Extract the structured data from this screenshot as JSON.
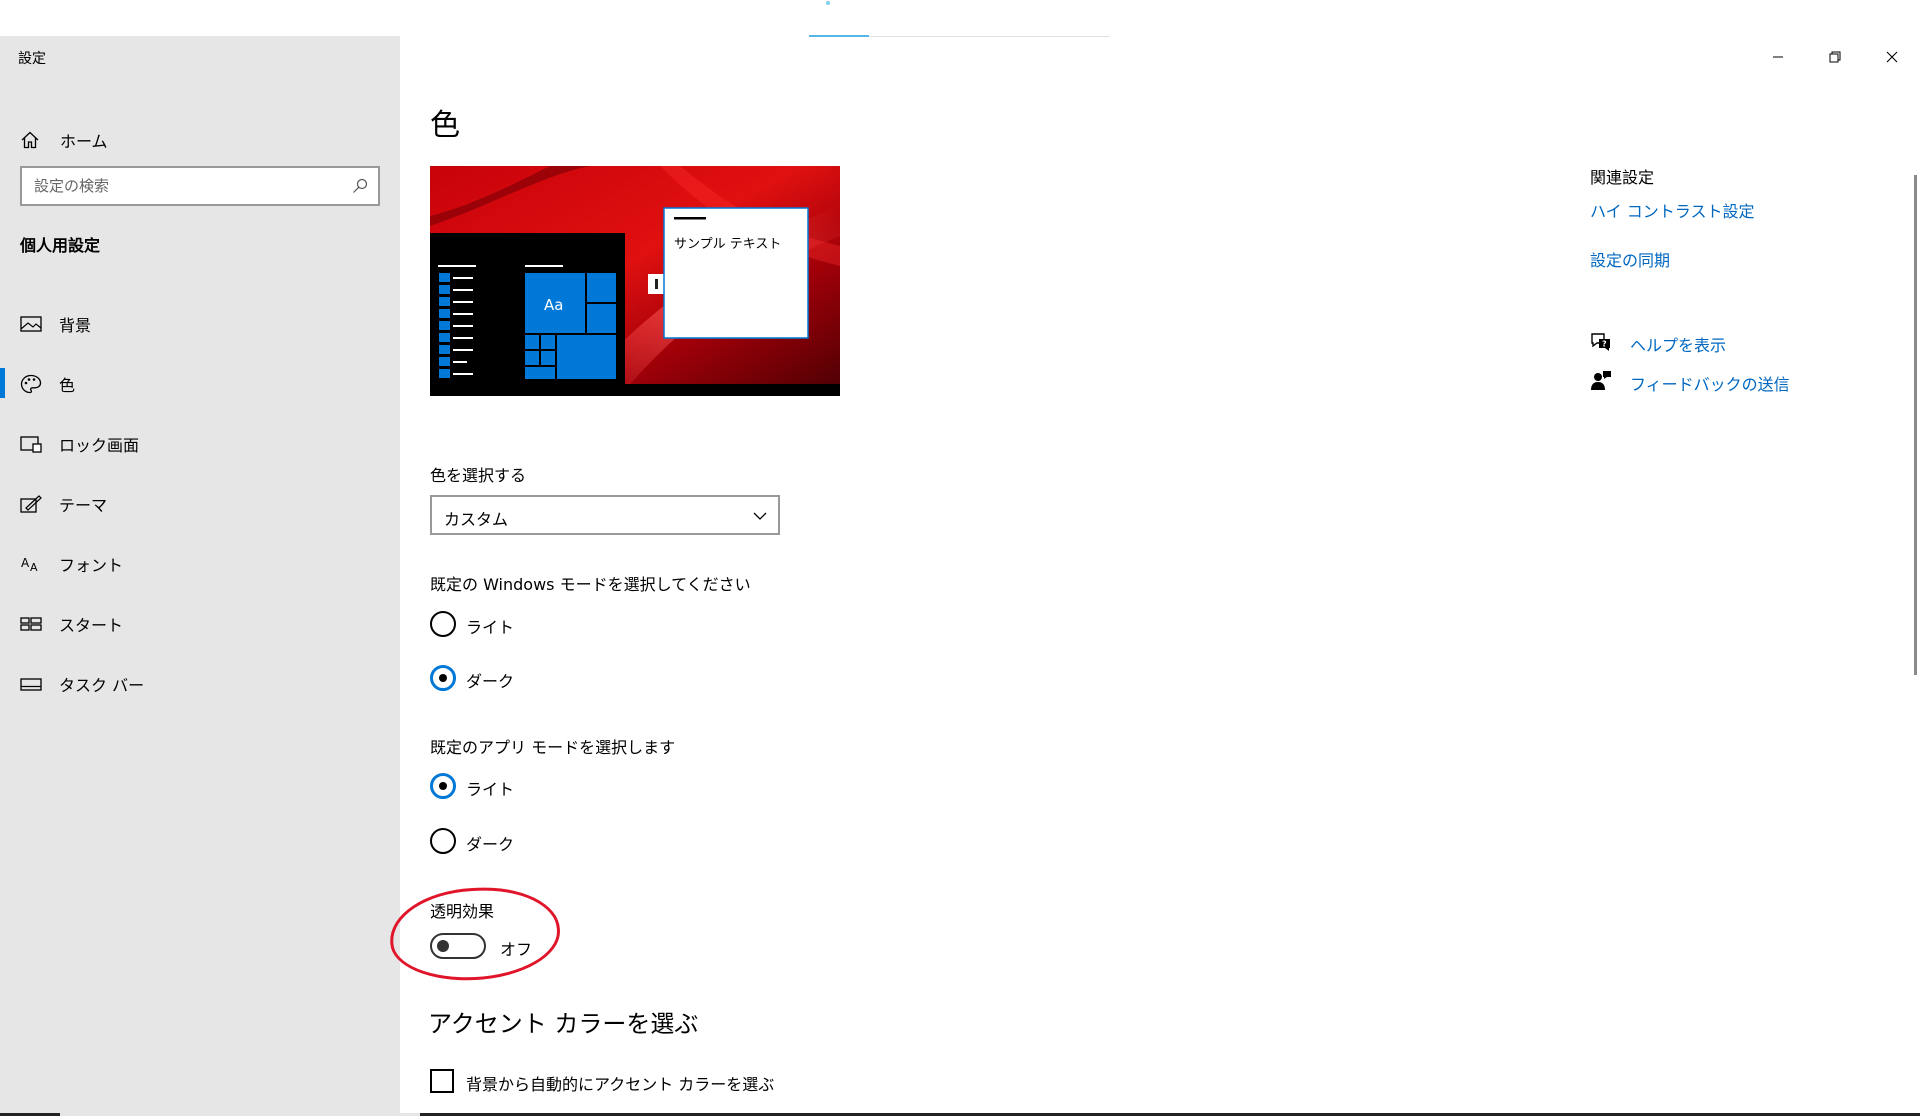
{
  "window": {
    "title": "設定",
    "controls": {
      "minimize": "minimize-icon",
      "maximize": "restore-icon",
      "close": "close-icon"
    }
  },
  "sidebar": {
    "home_label": "ホーム",
    "search_placeholder": "設定の検索",
    "section_title": "個人用設定",
    "items": [
      {
        "label": "背景",
        "icon": "picture-icon"
      },
      {
        "label": "色",
        "icon": "palette-icon",
        "active": true
      },
      {
        "label": "ロック画面",
        "icon": "lock-screen-icon"
      },
      {
        "label": "テーマ",
        "icon": "theme-icon"
      },
      {
        "label": "フォント",
        "icon": "font-icon"
      },
      {
        "label": "スタート",
        "icon": "start-icon"
      },
      {
        "label": "タスク バー",
        "icon": "taskbar-icon"
      }
    ]
  },
  "main": {
    "title": "色",
    "preview": {
      "sample_text": "サンプル テキスト",
      "tile_text": "Aa"
    },
    "choose_color": {
      "label": "色を選択する",
      "value": "カスタム"
    },
    "windows_mode": {
      "label": "既定の Windows モードを選択してください",
      "options": [
        {
          "label": "ライト",
          "checked": false
        },
        {
          "label": "ダーク",
          "checked": true
        }
      ]
    },
    "app_mode": {
      "label": "既定のアプリ モードを選択します",
      "options": [
        {
          "label": "ライト",
          "checked": true
        },
        {
          "label": "ダーク",
          "checked": false
        }
      ]
    },
    "transparency": {
      "label": "透明効果",
      "state": "オフ",
      "on": false
    },
    "accent": {
      "heading": "アクセント カラーを選ぶ",
      "auto_checkbox": "背景から自動的にアクセント カラーを選ぶ",
      "auto_checked": false
    }
  },
  "related": {
    "title": "関連設定",
    "links": [
      "ハイ コントラスト設定",
      "設定の同期"
    ],
    "help": [
      {
        "label": "ヘルプを表示",
        "icon": "help-chat-icon"
      },
      {
        "label": "フィードバックの送信",
        "icon": "feedback-icon"
      }
    ]
  },
  "colors": {
    "accent": "#0078d7",
    "link": "#0067c0",
    "sidebar_bg": "#e6e6e6",
    "annotation": "#e0152a"
  }
}
